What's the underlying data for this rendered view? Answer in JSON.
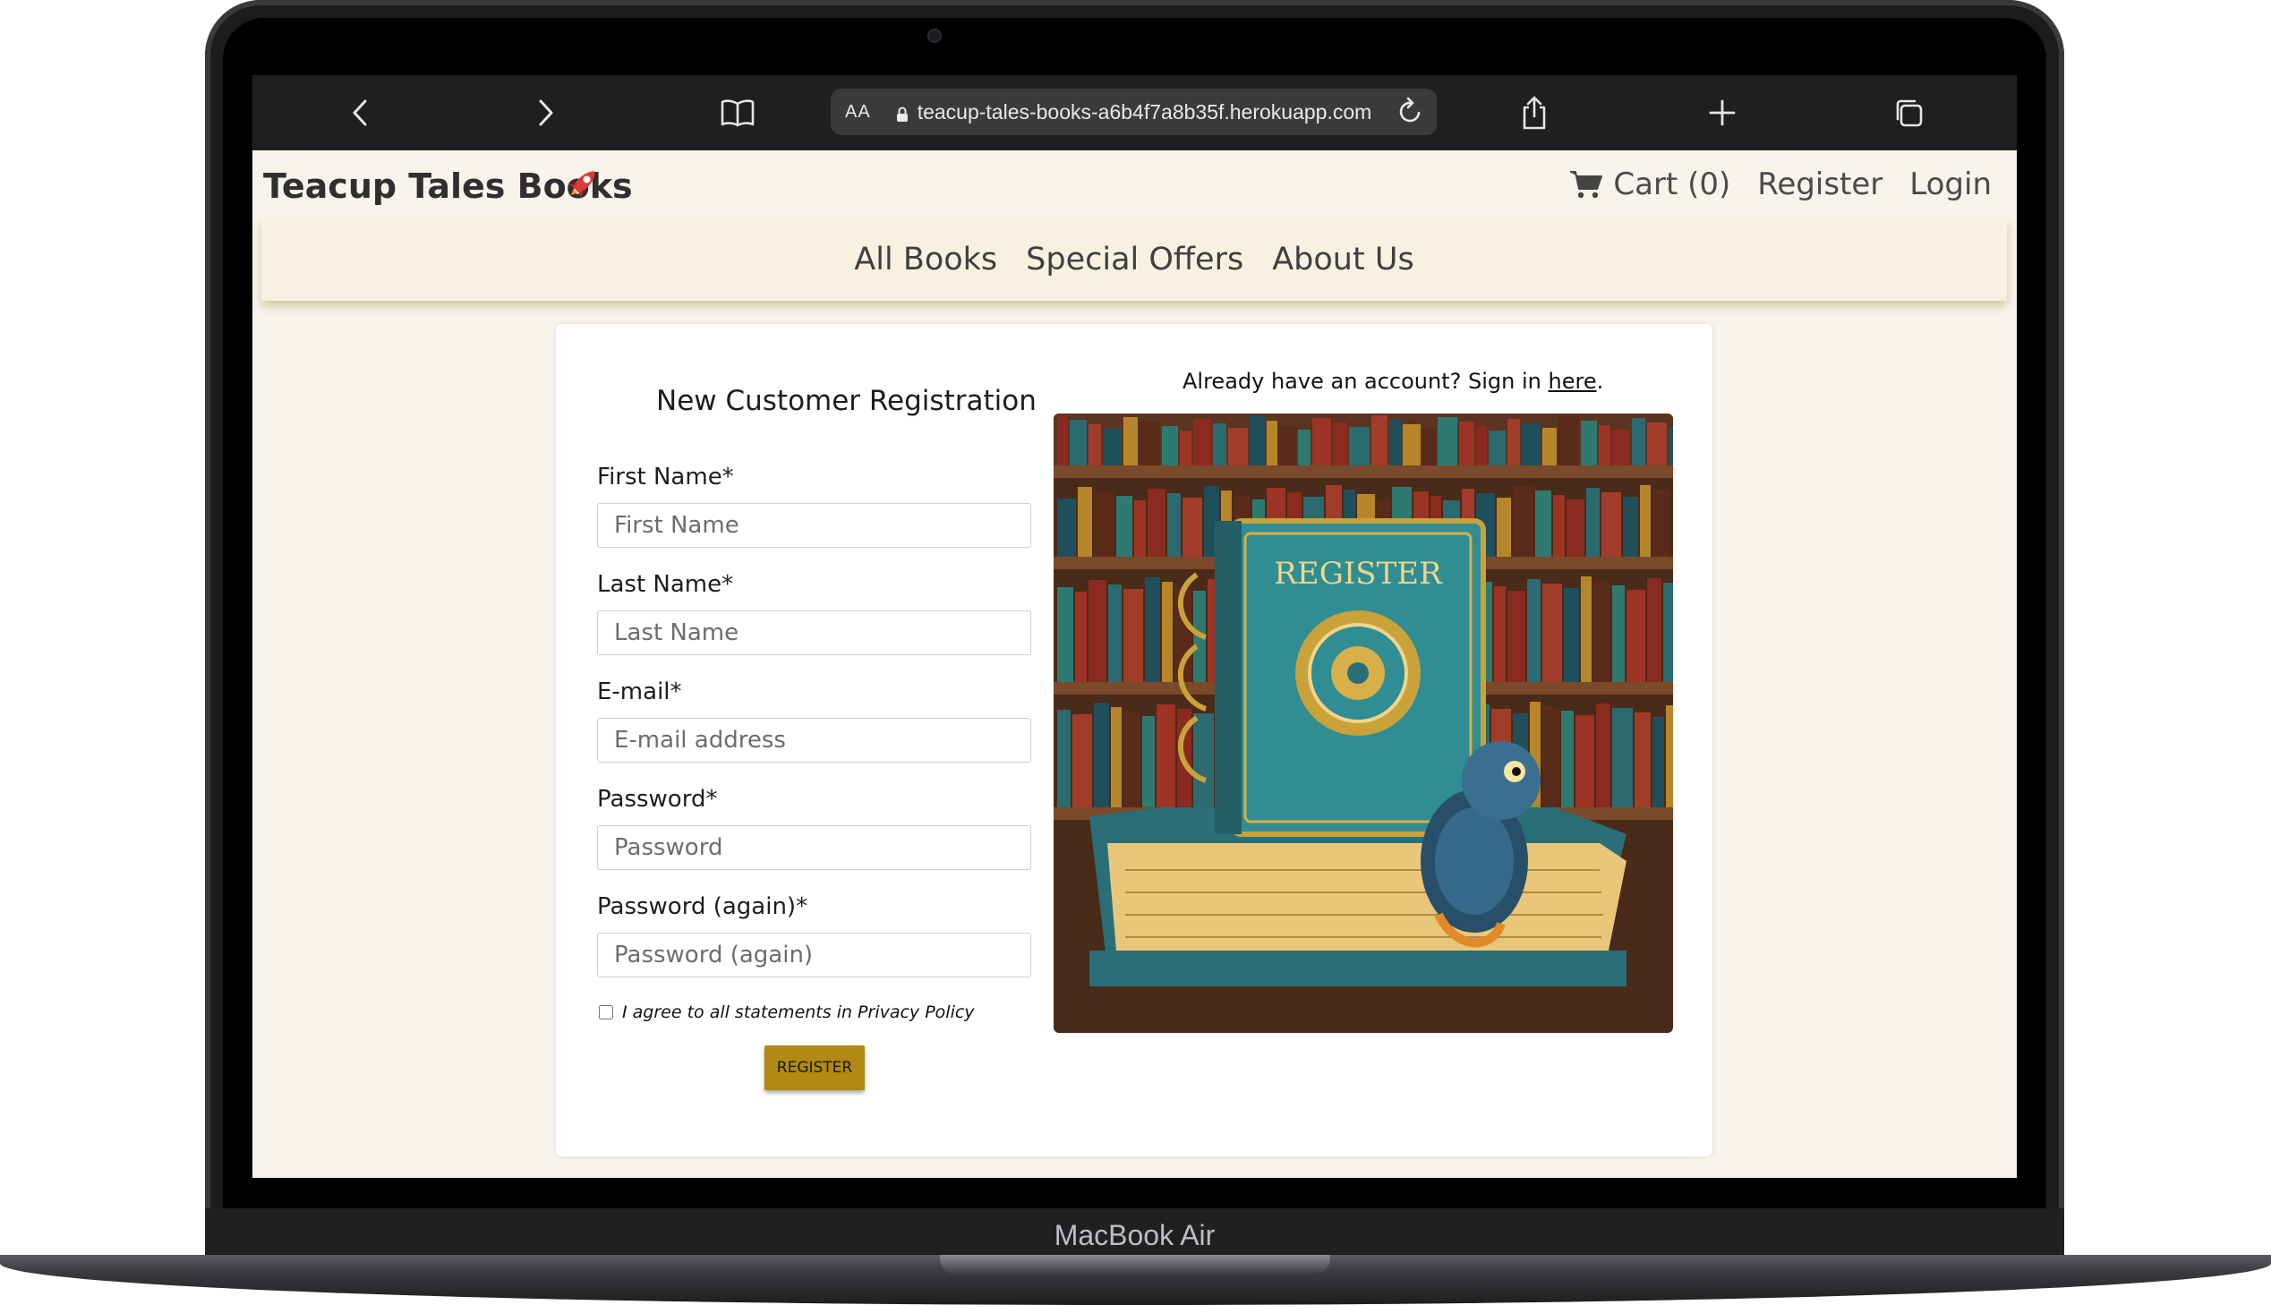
{
  "device": {
    "label": "MacBook Air"
  },
  "browser": {
    "text_size_label": "AA",
    "url": "teacup-tales-books-a6b4f7a8b35f.herokuapp.com",
    "icons": [
      "chevron-left-icon",
      "chevron-right-icon",
      "book-icon",
      "lock-icon",
      "reload-icon",
      "share-icon",
      "plus-icon",
      "tabs-icon"
    ]
  },
  "header": {
    "brand": "Teacup Tales Books",
    "cart_label": "Cart (0)",
    "register_label": "Register",
    "login_label": "Login"
  },
  "nav": {
    "items": [
      "All Books",
      "Special Offers",
      "About Us"
    ]
  },
  "form": {
    "title": "New Customer Registration",
    "fields": [
      {
        "label": "First Name*",
        "placeholder": "First Name"
      },
      {
        "label": "Last Name*",
        "placeholder": "Last Name"
      },
      {
        "label": "E-mail*",
        "placeholder": "E-mail address"
      },
      {
        "label": "Password*",
        "placeholder": "Password"
      },
      {
        "label": "Password (again)*",
        "placeholder": "Password (again)"
      }
    ],
    "agree_text": "I agree to all statements in Privacy Policy",
    "submit_label": "REGISTER"
  },
  "signin": {
    "prefix": "Already have an account? Sign in ",
    "link": "here",
    "suffix": "."
  },
  "illustration": {
    "title": "REGISTER"
  },
  "colors": {
    "page_bg": "#f8f4ec",
    "nav_bg": "#f8f1e2",
    "button_bg": "#b08a13",
    "brand_icon": "#d93a3a",
    "toolbar_bg": "#1f1f21"
  }
}
